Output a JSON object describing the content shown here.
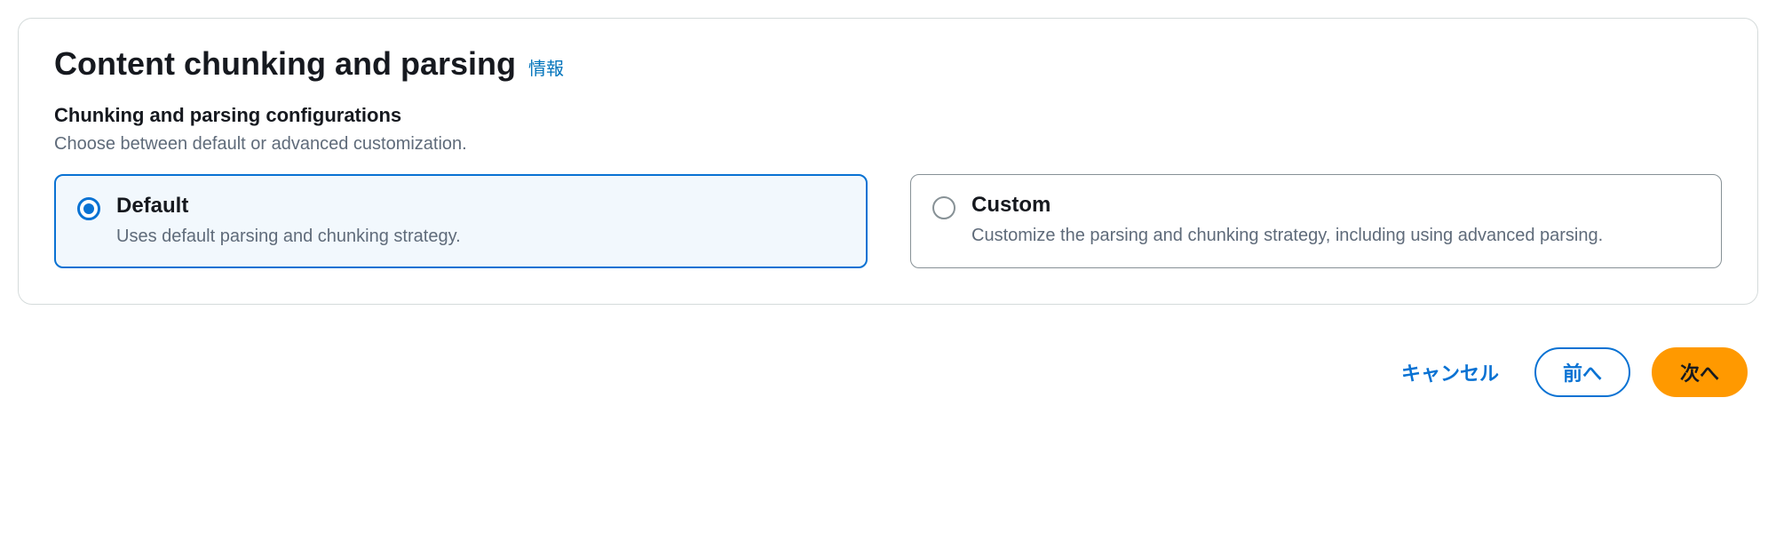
{
  "panel": {
    "title": "Content chunking and parsing",
    "info_link": "情報",
    "sub_heading": "Chunking and parsing configurations",
    "sub_desc": "Choose between default or advanced customization."
  },
  "options": {
    "default": {
      "title": "Default",
      "desc": "Uses default parsing and chunking strategy.",
      "selected": true
    },
    "custom": {
      "title": "Custom",
      "desc": "Customize the parsing and chunking strategy, including using advanced parsing.",
      "selected": false
    }
  },
  "actions": {
    "cancel": "キャンセル",
    "previous": "前へ",
    "next": "次へ"
  }
}
